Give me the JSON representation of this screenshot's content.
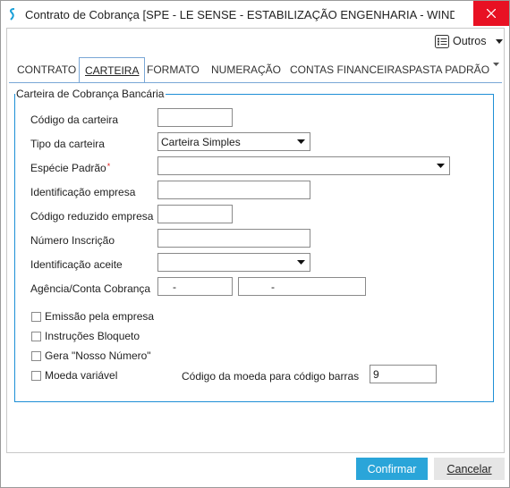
{
  "window": {
    "title": "Contrato de Cobrança [SPE - LE SENSE - ESTABILIZAÇÃO ENGENHARIA - WINDOW...",
    "close_icon": "close-icon"
  },
  "toolbar": {
    "outros_label": "Outros"
  },
  "tabs": [
    {
      "label": "CONTRATO"
    },
    {
      "label": "CARTEIRA"
    },
    {
      "label": "FORMATO"
    },
    {
      "label": "NUMERAÇÃO"
    },
    {
      "label": "CONTAS FINANCEIRAS"
    },
    {
      "label": "PASTA PADRÃO"
    }
  ],
  "form": {
    "legend": "Carteira de Cobrança Bancária",
    "codigo_carteira": {
      "label": "Código da carteira",
      "value": ""
    },
    "tipo_carteira": {
      "label": "Tipo da carteira",
      "value": "Carteira Simples"
    },
    "especie_padrao": {
      "label": "Espécie Padrão",
      "required_mark": "*",
      "value": ""
    },
    "identificacao_empresa": {
      "label": "Identificação empresa",
      "value": ""
    },
    "codigo_reduzido_empresa": {
      "label": "Código reduzido empresa",
      "value": ""
    },
    "numero_inscricao": {
      "label": "Número Inscrição",
      "value": ""
    },
    "identificacao_aceite": {
      "label": "Identificação aceite",
      "value": ""
    },
    "agencia_conta": {
      "label": "Agência/Conta Cobrança",
      "agencia_value": "-",
      "conta_value": "-"
    },
    "emissao_empresa": {
      "label": "Emissão pela empresa",
      "checked": false
    },
    "instrucoes_bloqueto": {
      "label": "Instruções Bloqueto",
      "checked": false
    },
    "gera_nosso_numero": {
      "label": "Gera \"Nosso Número\"",
      "checked": false
    },
    "moeda_variavel": {
      "label": "Moeda variável",
      "checked": false
    },
    "codigo_moeda": {
      "label": "Código da moeda para código barras",
      "value": "9"
    }
  },
  "footer": {
    "confirm_label": "Confirmar",
    "cancel_label": "Cancelar"
  },
  "colors": {
    "accent": "#2aa5d9",
    "close": "#e81123",
    "fieldset_border": "#1e8fd6"
  }
}
